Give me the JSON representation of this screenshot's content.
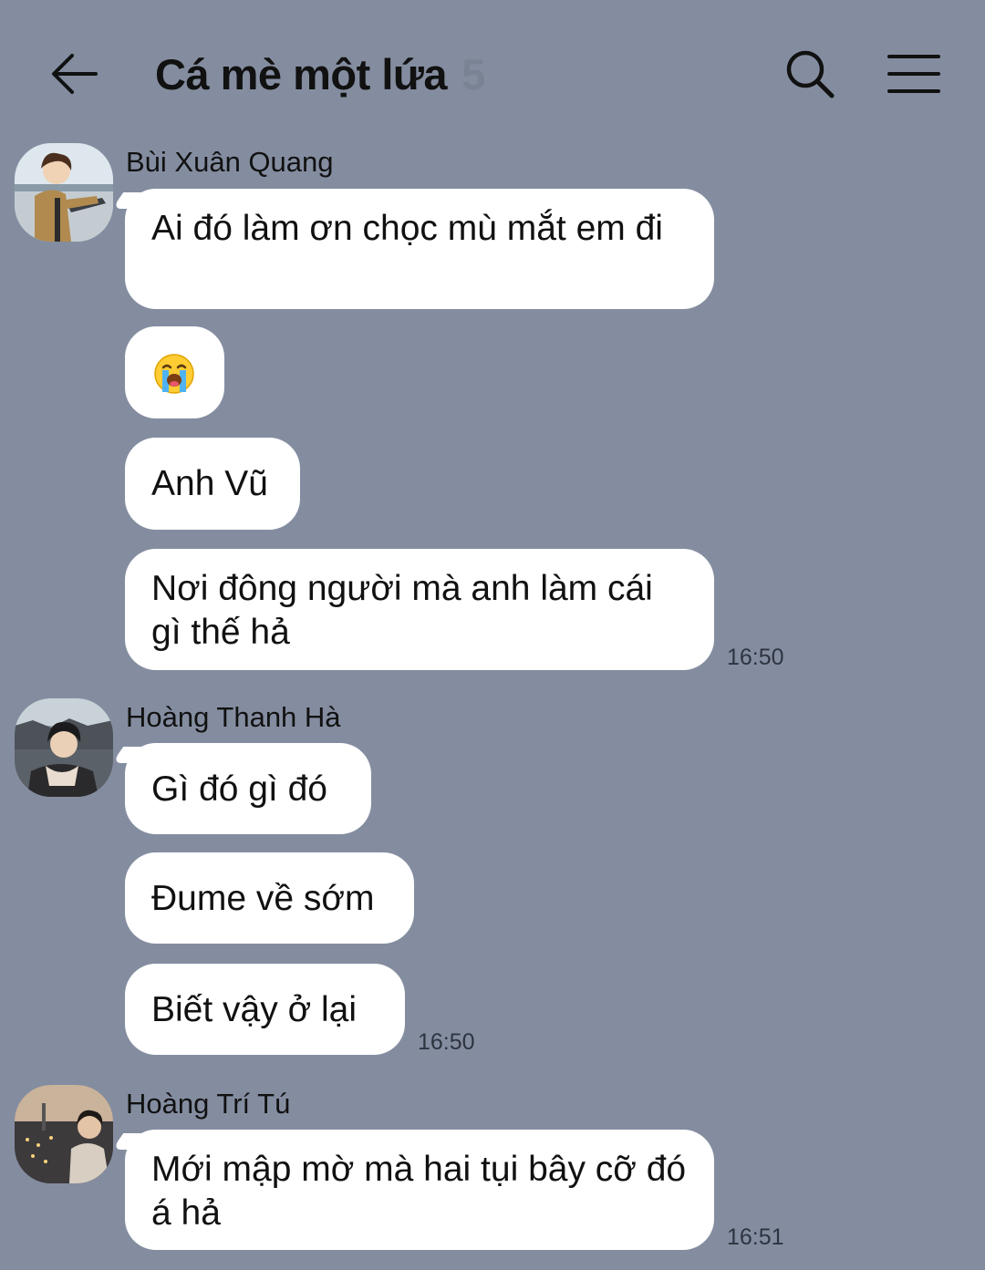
{
  "header": {
    "title": "Cá mè một lứa",
    "member_count": "5"
  },
  "groups": [
    {
      "sender": "Bùi Xuân Quang",
      "messages": [
        "Ai đó làm ơn chọc mù mắt em đi",
        "😭",
        "Anh Vũ",
        "Nơi đông người mà anh làm cái gì thế hả"
      ],
      "time": "16:50"
    },
    {
      "sender": "Hoàng Thanh Hà",
      "messages": [
        "Gì đó gì đó",
        "Đume về sớm",
        "Biết vậy ở lại"
      ],
      "time": "16:50"
    },
    {
      "sender": "Hoàng Trí Tú",
      "messages": [
        "Mới mập mờ mà hai tụi bây cỡ đó á hả"
      ],
      "time": "16:51"
    }
  ],
  "icons": {
    "back": "arrow-left-icon",
    "search": "search-icon",
    "menu": "hamburger-menu-icon",
    "emoji": "loudly-crying-face-emoji"
  },
  "colors": {
    "background": "#848da0",
    "bubble": "#ffffff",
    "member_count": "#7a8294"
  }
}
